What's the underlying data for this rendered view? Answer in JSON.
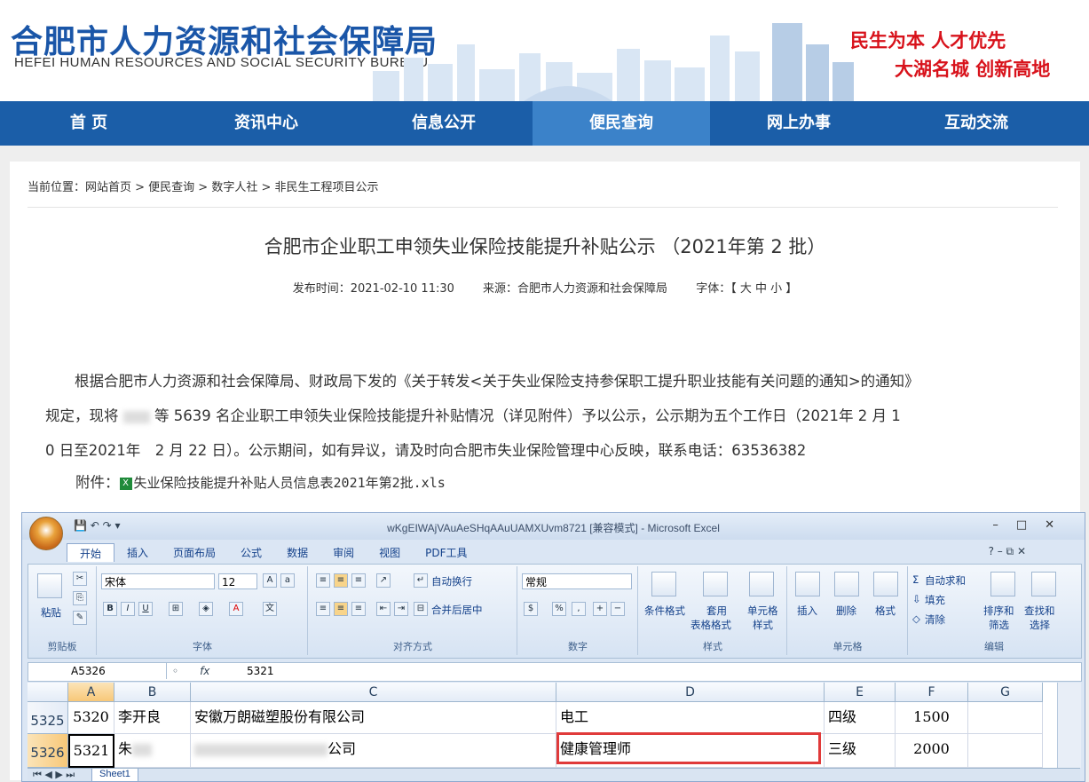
{
  "header": {
    "logo_cn": "合肥市人力资源和社会保障局",
    "logo_en": "HEFEI HUMAN RESOURCES AND SOCIAL SECURITY BUREAU",
    "slogan_1": "民生为本 人才优先",
    "slogan_2": "大湖名城 创新高地"
  },
  "nav": [
    "首 页",
    "资讯中心",
    "信息公开",
    "便民查询",
    "网上办事",
    "互动交流"
  ],
  "nav_active": "便民查询",
  "breadcrumb": "当前位置：网站首页 > 便民查询 > 数字人社 > 非民生工程项目公示",
  "article": {
    "title": "合肥市企业职工申领失业保险技能提升补贴公示 （2021年第 2 批）",
    "publish_time": "发布时间：2021-02-10 11:30",
    "source": "来源：合肥市人力资源和社会保障局",
    "font_size": "字体：【 大 中 小 】",
    "para_line1": "根据合肥市人力资源和社会保障局、财政局下发的《关于转发<关于失业保险支持参保职工提升职业技能有关问题的通知>的通知》",
    "para_line2_pre": "规定，现将",
    "para_line2_post": " 等 5639 名企业职工申领失业保险技能提升补贴情况（详见附件）予以公示，公示期为五个工作日（2021年 2 月 1",
    "para_line3": "0 日至2021年　2 月 22 日）。公示期间，如有异议，请及时向合肥市失业保险管理中心反映，联系电话：63536382",
    "attach_label": "附件：",
    "attach_file": "失业保险技能提升补贴人员信息表2021年第2批.xls"
  },
  "excel": {
    "caption": "wKgEIWAjVAuAeSHqAAuUAMXUvm8721 [兼容模式] - Microsoft Excel",
    "tabs": [
      "开始",
      "插入",
      "页面布局",
      "公式",
      "数据",
      "审阅",
      "视图",
      "PDF工具"
    ],
    "font_name": "宋体",
    "font_size": "12",
    "number_format": "常规",
    "groups": {
      "clipboard": "剪贴板",
      "font": "字体",
      "align": "对齐方式",
      "number": "数字",
      "styles": "样式",
      "cells": "单元格",
      "edit": "编辑"
    },
    "buttons": {
      "paste": "粘贴",
      "wrap": "自动换行",
      "merge": "合并后居中",
      "cond_format": "条件格式",
      "table_format_1": "套用",
      "table_format_2": "表格格式",
      "cell_style_1": "单元格",
      "cell_style_2": "样式",
      "insert": "插入",
      "delete": "删除",
      "format": "格式",
      "autosum": "自动求和",
      "fill": "填充",
      "clear": "清除",
      "sort_1": "排序和",
      "sort_2": "筛选",
      "find_1": "查找和",
      "find_2": "选择"
    },
    "name_box": "A5326",
    "formula": "5321",
    "columns": [
      "A",
      "B",
      "C",
      "D",
      "E",
      "F",
      "G"
    ],
    "rows": [
      {
        "row": "5325",
        "a": "5320",
        "b": "李开良",
        "c": "安徽万朗磁塑股份有限公司",
        "d": "电工",
        "e": "四级",
        "f": "1500"
      },
      {
        "row": "5326",
        "a": "5321",
        "b": "朱",
        "c": "公司",
        "d": "健康管理师",
        "e": "三级",
        "f": "2000"
      }
    ],
    "sheet_tab": "Sheet1"
  }
}
